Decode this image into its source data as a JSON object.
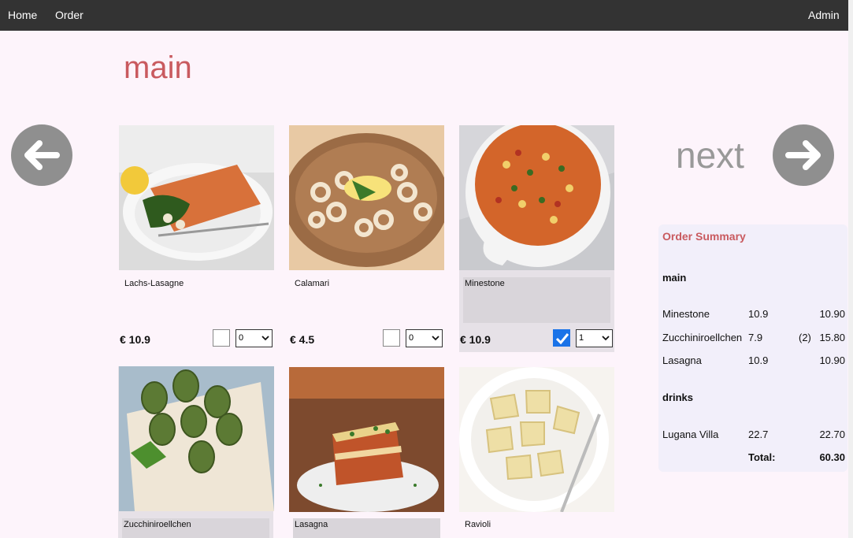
{
  "nav": {
    "home": "Home",
    "order": "Order",
    "admin": "Admin"
  },
  "page": {
    "title": "main",
    "next_label": "next"
  },
  "items": [
    {
      "name": "Lachs-Lasagne",
      "price": "€ 10.9",
      "checked": false,
      "qty": "0"
    },
    {
      "name": "Calamari",
      "price": "€ 4.5",
      "checked": false,
      "qty": "0"
    },
    {
      "name": "Minestone",
      "price": "€ 10.9",
      "checked": true,
      "qty": "1"
    },
    {
      "name": "Zucchiniroellchen"
    },
    {
      "name": "Lasagna"
    },
    {
      "name": "Ravioli"
    }
  ],
  "summary": {
    "title": "Order Summary",
    "sections": [
      {
        "name": "main",
        "rows": [
          {
            "name": "Minestone",
            "price": "10.9",
            "qty": "",
            "total": "10.90"
          },
          {
            "name": "Zucchiniroellchen",
            "price": "7.9",
            "qty": "(2)",
            "total": "15.80"
          },
          {
            "name": "Lasagna",
            "price": "10.9",
            "qty": "",
            "total": "10.90"
          }
        ]
      },
      {
        "name": "drinks",
        "rows": [
          {
            "name": "Lugana Villa",
            "price": "22.7",
            "qty": "",
            "total": "22.70"
          }
        ]
      }
    ],
    "total_label": "Total:",
    "total_value": "60.30"
  },
  "colors": {
    "accent": "#c95a5f",
    "nav_bg": "#333333",
    "checkbox": "#1a73e8"
  }
}
